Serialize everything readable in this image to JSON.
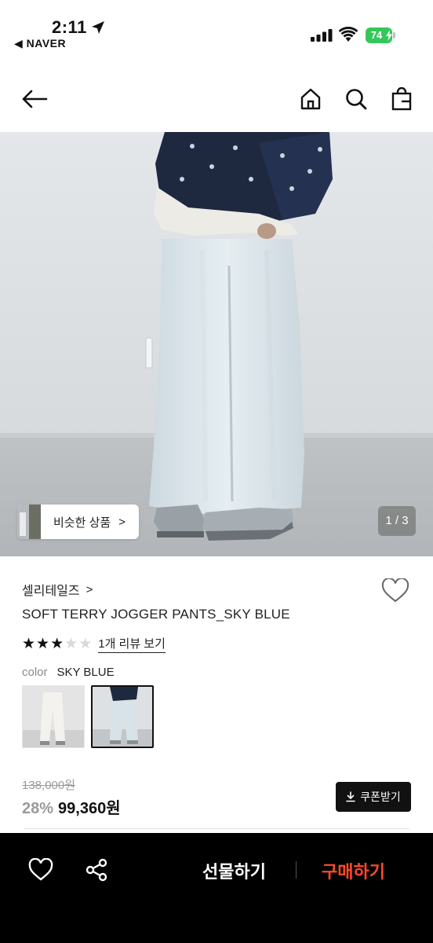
{
  "status_bar": {
    "time": "2:11",
    "back_app": "◀ NAVER",
    "battery": "74"
  },
  "header": {
    "icons": [
      "back-arrow-icon",
      "home-icon",
      "search-icon",
      "shopping-bag-icon"
    ]
  },
  "gallery": {
    "similar_label": "비슷한 상품",
    "similar_chevron": ">",
    "pager": "1 / 3"
  },
  "product": {
    "brand": "셀리테일즈",
    "brand_chevron": ">",
    "title": "SOFT TERRY JOGGER PANTS_SKY BLUE",
    "rating": 3,
    "rating_max": 5,
    "review_link": "1개 리뷰 보기",
    "color_label": "color",
    "color_value": "SKY BLUE",
    "original_price": "138,000원",
    "discount": "28%",
    "sale_price": "99,360원",
    "coupon_label": "쿠폰받기"
  },
  "bottom_bar": {
    "gift_label": "선물하기",
    "buy_label": "구매하기",
    "buy_color": "#ff4a2a"
  }
}
